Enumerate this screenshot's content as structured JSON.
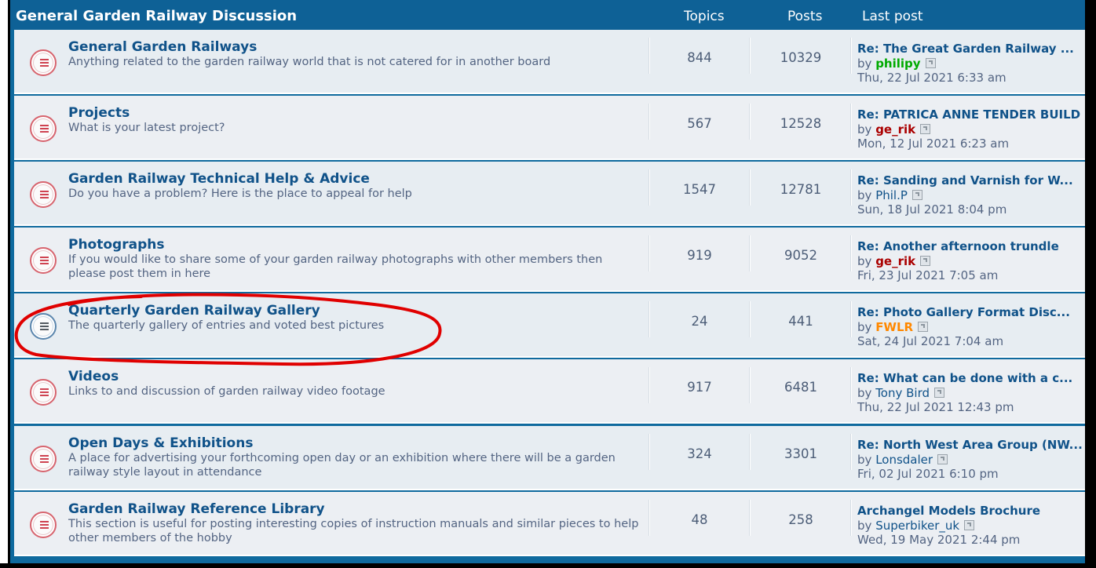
{
  "header": {
    "category_title": "General Garden Railway Discussion",
    "col_topics": "Topics",
    "col_posts": "Posts",
    "col_last_post": "Last post"
  },
  "by_label": "by",
  "forums": [
    {
      "name": "General Garden Railways",
      "description": "Anything related to the garden railway world that is not catered for in another board",
      "topics": "844",
      "posts": "10329",
      "last_post_title": "Re: The Great Garden Railway ...",
      "last_post_user": "philipy",
      "last_post_user_color": "#00aa00",
      "last_post_time": "Thu, 22 Jul 2021 6:33 am",
      "unread": true
    },
    {
      "name": "Projects",
      "description": "What is your latest project?",
      "topics": "567",
      "posts": "12528",
      "last_post_title": "Re: PATRICA ANNE TENDER BUILD",
      "last_post_user": "ge_rik",
      "last_post_user_color": "#aa0000",
      "last_post_time": "Mon, 12 Jul 2021 6:23 am",
      "unread": true
    },
    {
      "name": "Garden Railway Technical Help & Advice",
      "description": "Do you have a problem? Here is the place to appeal for help",
      "topics": "1547",
      "posts": "12781",
      "last_post_title": "Re: Sanding and Varnish for W...",
      "last_post_user": "Phil.P",
      "last_post_user_color": "",
      "last_post_time": "Sun, 18 Jul 2021 8:04 pm",
      "unread": true
    },
    {
      "name": "Photographs",
      "description": "If you would like to share some of your garden railway photographs with other members then please post them in here",
      "topics": "919",
      "posts": "9052",
      "last_post_title": "Re: Another afternoon trundle",
      "last_post_user": "ge_rik",
      "last_post_user_color": "#aa0000",
      "last_post_time": "Fri, 23 Jul 2021 7:05 am",
      "unread": true
    },
    {
      "name": "Quarterly Garden Railway Gallery",
      "description": "The quarterly gallery of entries and voted best pictures",
      "topics": "24",
      "posts": "441",
      "last_post_title": "Re: Photo Gallery Format Disc...",
      "last_post_user": "FWLR",
      "last_post_user_color": "#ff8800",
      "last_post_time": "Sat, 24 Jul 2021 7:04 am",
      "unread": false
    },
    {
      "name": "Videos",
      "description": "Links to and discussion of garden railway video footage",
      "topics": "917",
      "posts": "6481",
      "last_post_title": "Re: What can be done with a c...",
      "last_post_user": "Tony Bird",
      "last_post_user_color": "",
      "last_post_time": "Thu, 22 Jul 2021 12:43 pm",
      "unread": true
    },
    {
      "name": "Open Days & Exhibitions",
      "description": "A place for advertising your forthcoming open day or an exhibition where there will be a garden railway style layout in attendance",
      "topics": "324",
      "posts": "3301",
      "last_post_title": "Re: North West Area Group (NW...",
      "last_post_user": "Lonsdaler",
      "last_post_user_color": "",
      "last_post_time": "Fri, 02 Jul 2021 6:10 pm",
      "unread": true
    },
    {
      "name": "Garden Railway Reference Library",
      "description": "This section is useful for posting interesting copies of instruction manuals and similar pieces to help other members of the hobby",
      "topics": "48",
      "posts": "258",
      "last_post_title": "Archangel Models Brochure",
      "last_post_user": "Superbiker_uk",
      "last_post_user_color": "",
      "last_post_time": "Wed, 19 May 2021 2:44 pm",
      "unread": true
    }
  ],
  "colors": {
    "header_bg": "#0e6196",
    "row_bg": "#e7edf2",
    "link": "#105289",
    "text": "#536482",
    "annotation": "#e00000"
  }
}
